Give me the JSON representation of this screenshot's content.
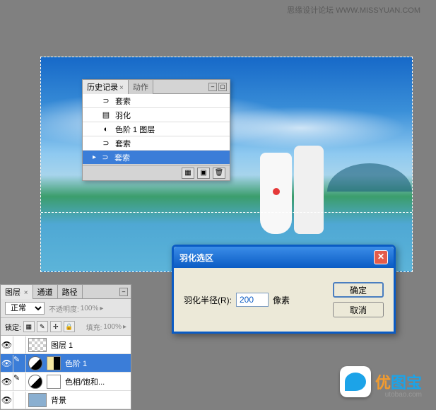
{
  "header": {
    "text": "思缘设计论坛 WWW.MISSYUAN.COM"
  },
  "history_panel": {
    "tabs": {
      "history": "历史记录",
      "actions": "动作"
    },
    "items": [
      {
        "icon": "lasso",
        "label": "套索"
      },
      {
        "icon": "document",
        "label": "羽化"
      },
      {
        "icon": "adjustment",
        "label": "色阶 1 图层"
      },
      {
        "icon": "lasso",
        "label": "套索"
      },
      {
        "icon": "lasso",
        "label": "套索",
        "selected": true
      }
    ]
  },
  "dialog": {
    "title": "羽化选区",
    "radius_label": "羽化半径(R):",
    "radius_value": "200",
    "unit": "像素",
    "ok": "确定",
    "cancel": "取消"
  },
  "layers_panel": {
    "tabs": {
      "layers": "图层",
      "channels": "通道",
      "paths": "路径"
    },
    "blend_mode": "正常",
    "opacity_label": "不透明度:",
    "opacity_value": "100%",
    "lock_label": "锁定:",
    "fill_label": "填充:",
    "fill_value": "100%",
    "layers": [
      {
        "name": "图层 1",
        "type": "bitmap"
      },
      {
        "name": "色阶 1",
        "type": "adjustment",
        "selected": true
      },
      {
        "name": "色相/饱和...",
        "type": "adjustment"
      },
      {
        "name": "背景",
        "type": "background"
      }
    ]
  },
  "watermark": {
    "brand": "优图宝",
    "url": "utobao.com"
  }
}
